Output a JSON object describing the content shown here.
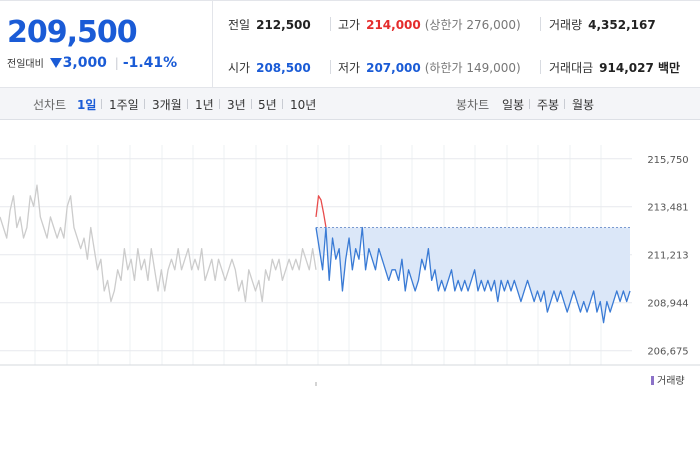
{
  "quote": {
    "price": "209,500",
    "change_label": "전일대비",
    "change_amount": "3,000",
    "change_rate": "-1.41%",
    "direction": "down",
    "colors": {
      "down": "#1a5bd6",
      "up": "#e42c2c"
    }
  },
  "stats": {
    "prev_close": {
      "label": "전일",
      "value": "212,500"
    },
    "high": {
      "label": "고가",
      "value": "214,000",
      "limit": "(상한가 276,000)"
    },
    "volume": {
      "label": "거래량",
      "value": "4,352,167"
    },
    "open": {
      "label": "시가",
      "value": "208,500"
    },
    "low": {
      "label": "저가",
      "value": "207,000",
      "limit": "(하한가 149,000)"
    },
    "trade_amount": {
      "label": "거래대금",
      "value": "914,027 백만"
    }
  },
  "tabs": {
    "line_chart_label": "선차트",
    "periods": [
      "1일",
      "1주일",
      "3개월",
      "1년",
      "3년",
      "5년",
      "10년"
    ],
    "active_period": "1일",
    "candle_chart_label": "봉차트",
    "candles": [
      "일봉",
      "주봉",
      "월봉"
    ]
  },
  "chart_data": {
    "type": "line",
    "ylim": [
      206000,
      216400
    ],
    "yticks": [
      "215,750",
      "213,481",
      "211,213",
      "208,944",
      "206,675"
    ],
    "grid": true,
    "reference_level": 212500,
    "volume_legend": "거래량",
    "series": [
      {
        "color": "#cccccc",
        "values": [
          213000,
          212500,
          212000,
          213300,
          214000,
          212500,
          213000,
          212000,
          212500,
          214000,
          213500,
          214500,
          213000,
          212500,
          212000,
          213000,
          212500,
          212000,
          212500,
          212000,
          213500,
          214000,
          212500,
          212000,
          211500,
          212000,
          211000,
          212500,
          211500,
          210500,
          211000,
          209500,
          210000,
          209000,
          209500,
          210500,
          210000,
          211500,
          210500,
          211000,
          210000,
          211500,
          210500,
          211000,
          210000,
          211500,
          210500,
          209500,
          210500,
          209500,
          210500,
          211000,
          210500,
          211500,
          210500,
          211000,
          211500,
          210500,
          211000,
          210500,
          211500,
          210000,
          210500,
          211000,
          210000,
          211000,
          210500,
          210000,
          210500,
          211000,
          210500,
          209500,
          210000,
          209000,
          210500,
          210000,
          209500,
          210000,
          209000,
          210500,
          210000,
          211000,
          210500,
          211000,
          210000,
          210500,
          211000,
          210500,
          211000,
          210500,
          211500,
          211000,
          210500,
          211500,
          210500
        ]
      },
      {
        "color": "#e84c4c",
        "values": [
          213000,
          214000,
          213800,
          213200,
          212500
        ]
      },
      {
        "color": "#3a7bd5",
        "values": [
          212500,
          211500,
          210500,
          212500,
          210000,
          212000,
          211000,
          211500,
          209500,
          211000,
          212000,
          210500,
          211500,
          211000,
          212500,
          210500,
          211500,
          211000,
          210500,
          211500,
          211000,
          210500,
          210000,
          210500,
          210500,
          210000,
          211000,
          209500,
          210500,
          210000,
          209500,
          210000,
          211000,
          210500,
          211500,
          210000,
          210500,
          209500,
          210000,
          209500,
          210000,
          210500,
          209500,
          210000,
          209500,
          210000,
          209500,
          210000,
          210500,
          209500,
          210000,
          209500,
          210000,
          209500,
          210000,
          209000,
          210000,
          209500,
          210000,
          209500,
          210000,
          209500,
          209000,
          209500,
          210000,
          209500,
          209000,
          209500,
          209000,
          209500,
          208500,
          209000,
          209500,
          209000,
          209500,
          209000,
          208500,
          209000,
          209500,
          209000,
          208500,
          209000,
          208500,
          209000,
          209500,
          208500,
          209000,
          208000,
          209000,
          208500,
          209000,
          209500,
          209000,
          209500,
          209000,
          209500
        ]
      }
    ]
  }
}
